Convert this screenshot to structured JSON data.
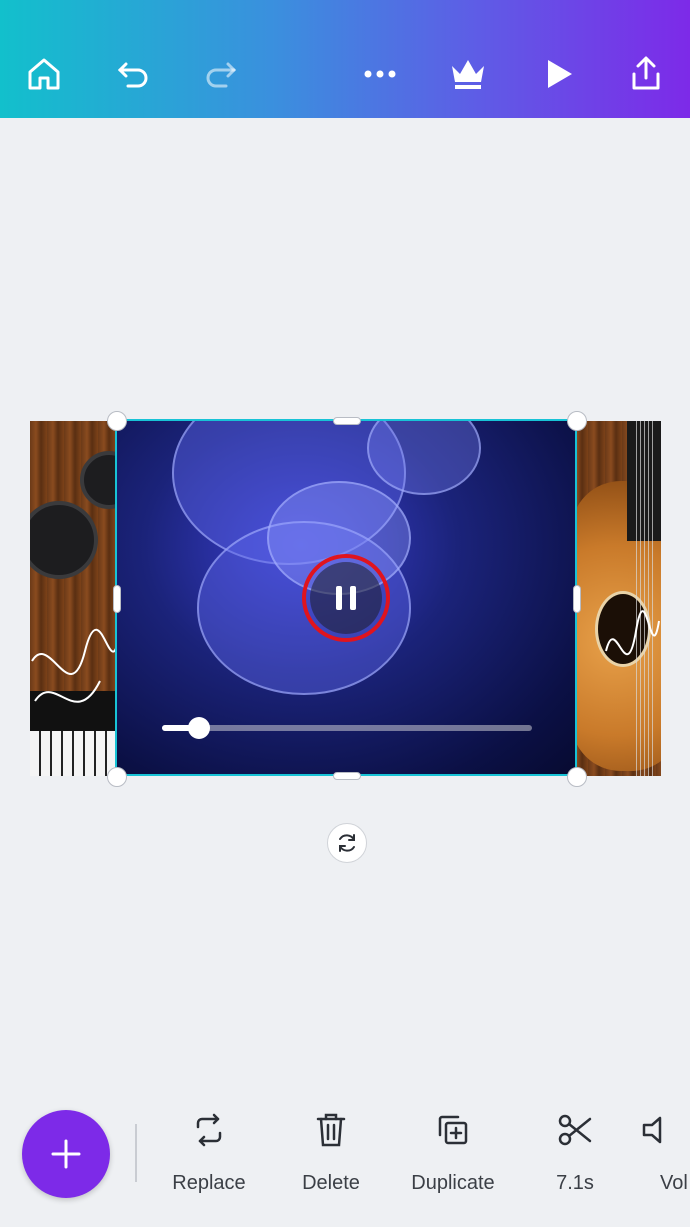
{
  "topbar": {
    "icons": [
      "home-icon",
      "undo-icon",
      "redo-icon",
      "more-icon",
      "crown-icon",
      "play-icon",
      "share-icon"
    ]
  },
  "colors": {
    "accent": "#7d2ae8",
    "selection": "#18c3d6",
    "highlight_ring": "#e0141e"
  },
  "video": {
    "state": "playing",
    "progress_fraction": 0.1
  },
  "toolbar": {
    "add_icon": "plus-icon",
    "replace_label": "Replace",
    "delete_label": "Delete",
    "duplicate_label": "Duplicate",
    "trim_label": "7.1s",
    "volume_label": "Vol"
  }
}
